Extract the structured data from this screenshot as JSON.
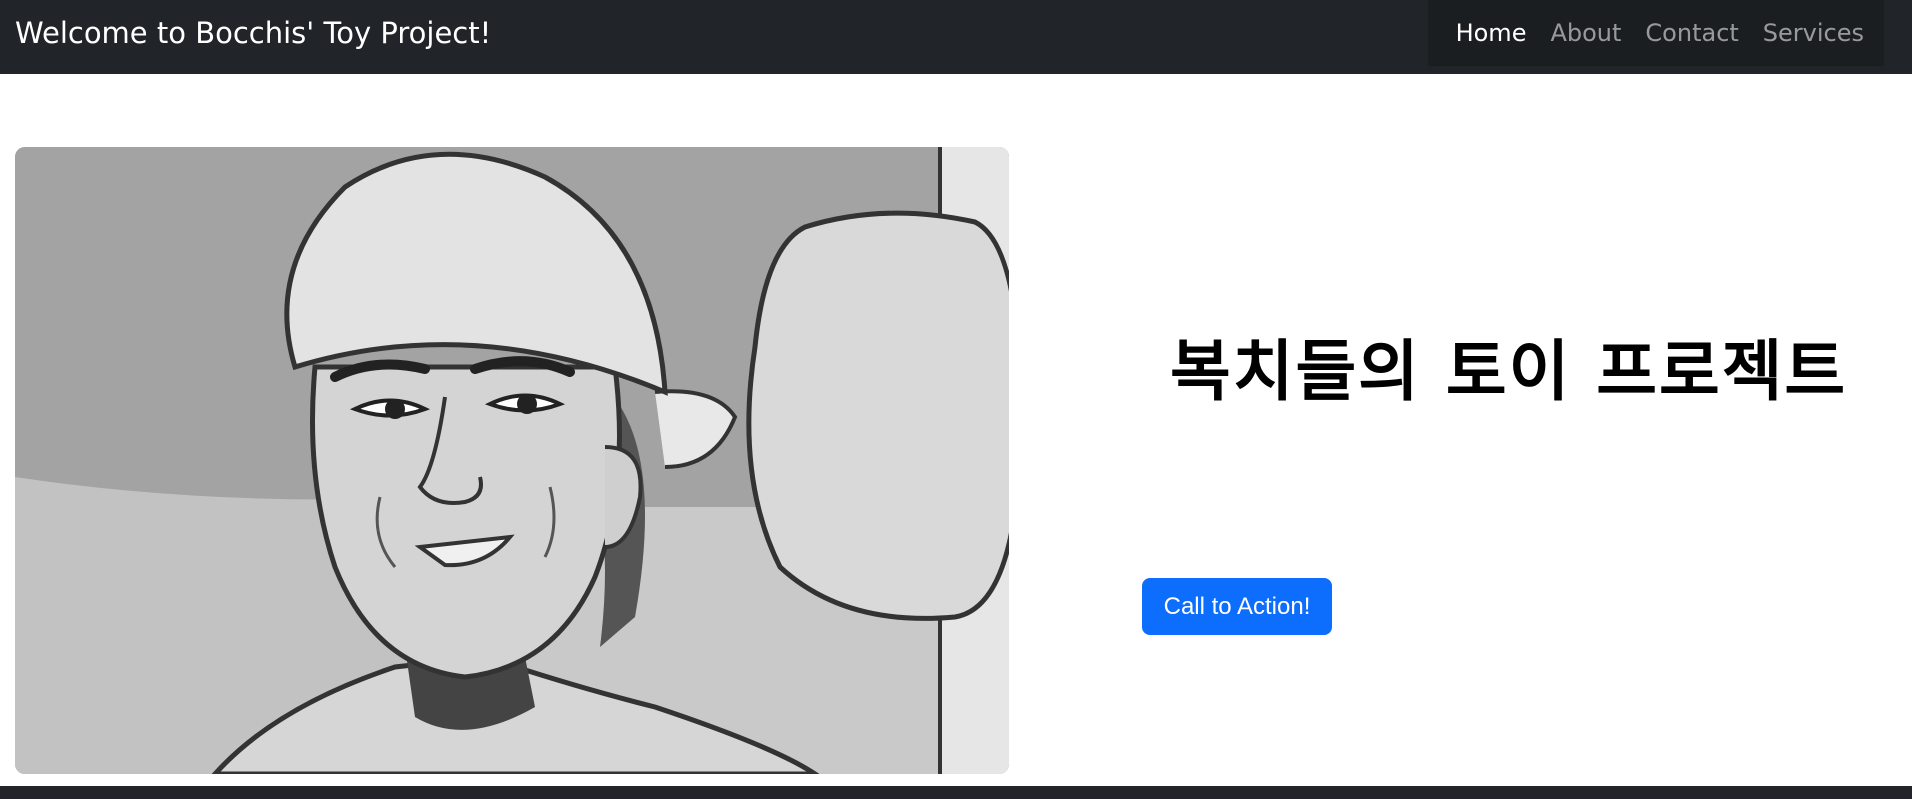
{
  "navbar": {
    "brand": "Welcome to Bocchis' Toy Project!",
    "links": [
      {
        "label": "Home",
        "active": true
      },
      {
        "label": "About",
        "active": false
      },
      {
        "label": "Contact",
        "active": false
      },
      {
        "label": "Services",
        "active": false
      }
    ]
  },
  "hero": {
    "title": "복치들의 토이 프로젝트",
    "cta_label": "Call to Action!"
  },
  "colors": {
    "navbar_bg": "#212529",
    "primary": "#0d6efd",
    "nav_inactive": "rgba(255,255,255,0.55)"
  }
}
